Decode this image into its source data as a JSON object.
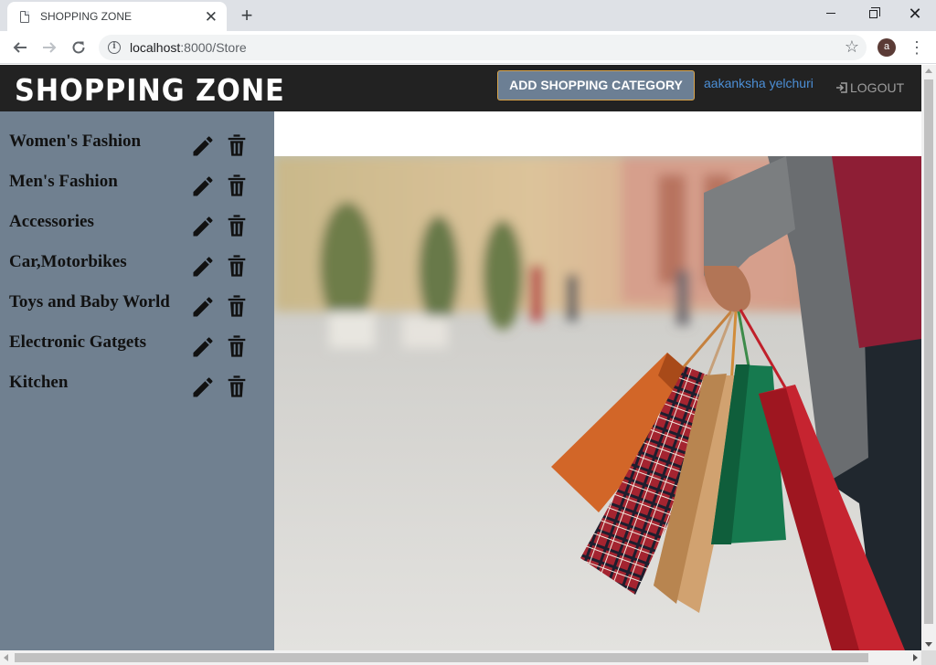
{
  "browser": {
    "tab_title": "SHOPPING ZONE",
    "tab_close": "✕",
    "new_tab": "+",
    "url_host": "localhost",
    "url_path": ":8000/Store",
    "profile_initial": "a",
    "menu_icon": "⋮"
  },
  "app": {
    "brand": "SHOPPING ZONE",
    "add_category_label": "ADD SHOPPING CATEGORY",
    "user_name": "aakanksha yelchuri",
    "logout_label": "LOGOUT",
    "colors": {
      "header_bg": "#222222",
      "sidebar_bg": "#708090",
      "button_bg": "#6c7f94",
      "button_border": "#d9a44a",
      "user_link": "#4c8fd6"
    }
  },
  "sidebar": {
    "items": [
      {
        "label": "Women's Fashion"
      },
      {
        "label": "Men's Fashion"
      },
      {
        "label": "Accessories"
      },
      {
        "label": "Car,Motorbikes"
      },
      {
        "label": "Toys and Baby World"
      },
      {
        "label": "Electronic Gatgets"
      },
      {
        "label": "Kitchen"
      }
    ],
    "item_icons": [
      "pencil-icon",
      "trash-icon"
    ]
  },
  "hero": {
    "image_subject": "shopping-bags-street-photo"
  }
}
